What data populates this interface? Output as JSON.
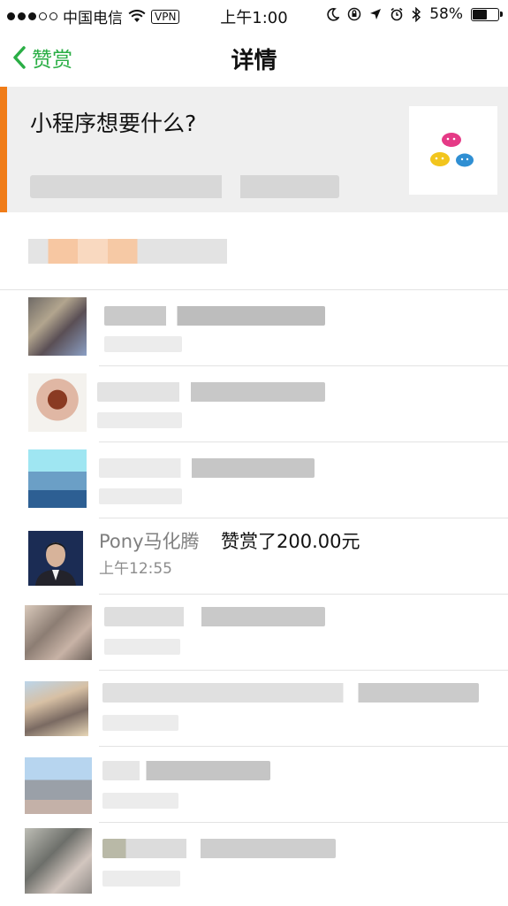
{
  "status_bar": {
    "carrier": "中国电信",
    "vpn": "VPN",
    "time": "上午1:00",
    "battery": "58%"
  },
  "nav": {
    "back_label": "赞赏",
    "title": "详情"
  },
  "header": {
    "title": "小程序想要什么?",
    "accent_color": "#f07c18"
  },
  "list": {
    "highlighted": {
      "name": "Pony马化腾",
      "action": "赞赏了200.00元",
      "time": "上午12:55"
    }
  },
  "colors": {
    "brand_green": "#2aae45",
    "orange": "#f07c18"
  }
}
